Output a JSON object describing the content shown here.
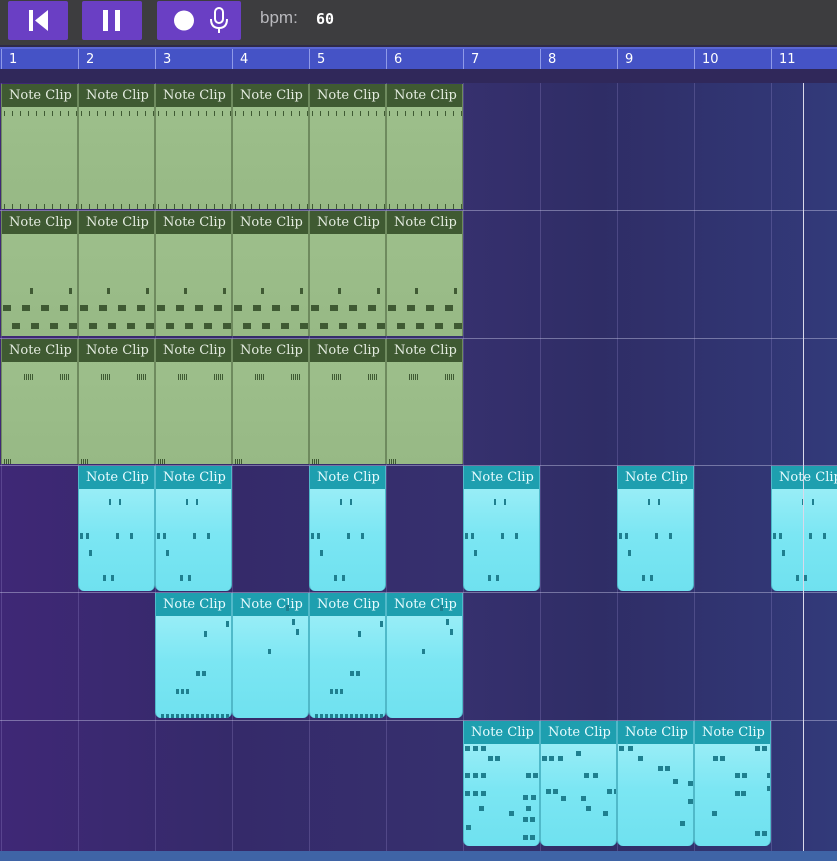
{
  "toolbar": {
    "bpm_label": "bpm:",
    "bpm_value": "60",
    "accent_color": "#6a3fc4"
  },
  "ruler": {
    "bars": [
      "1",
      "2",
      "3",
      "4",
      "5",
      "6",
      "7",
      "8",
      "9",
      "10",
      "11"
    ]
  },
  "clip_label": "Note Clip",
  "tracks": [
    {
      "color": "green",
      "clips": [
        1,
        2,
        3,
        4,
        5,
        6
      ]
    },
    {
      "color": "green",
      "clips": [
        1,
        2,
        3,
        4,
        5,
        6
      ]
    },
    {
      "color": "green",
      "clips": [
        1,
        2,
        3,
        4,
        5,
        6
      ]
    },
    {
      "color": "cyan",
      "clips": [
        2,
        3,
        5,
        7,
        9,
        11
      ]
    },
    {
      "color": "cyan",
      "clips": [
        3,
        4,
        5,
        6
      ]
    },
    {
      "color": "cyan",
      "clips": [
        7,
        8,
        9,
        10
      ]
    }
  ],
  "colors": {
    "green_clip": "#9ec08c",
    "green_header": "#3f5a32",
    "cyan_clip": "#7be6f3",
    "cyan_header": "#1e9faf",
    "ruler": "#4553c6"
  }
}
